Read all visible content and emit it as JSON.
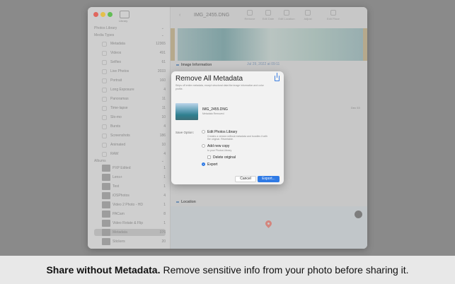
{
  "window": {
    "title": "IMG_2455.DNG",
    "traffic_colors": [
      "#e0675e",
      "#e5c04b",
      "#62bd55"
    ],
    "accent": "#2f7ae5"
  },
  "sidebar": {
    "top_label": "Library",
    "library_label": "Photos Library",
    "media_types_label": "Media Types",
    "media_types": [
      {
        "label": "Metadata",
        "count": "12365"
      },
      {
        "label": "Videos",
        "count": "491"
      },
      {
        "label": "Selfies",
        "count": "61"
      },
      {
        "label": "Live Photos",
        "count": "2033"
      },
      {
        "label": "Portrait",
        "count": "160"
      },
      {
        "label": "Long Exposure",
        "count": "4"
      },
      {
        "label": "Panoramas",
        "count": "11"
      },
      {
        "label": "Time-lapse",
        "count": "11"
      },
      {
        "label": "Slo-mo",
        "count": "10"
      },
      {
        "label": "Bursts",
        "count": "4"
      },
      {
        "label": "Screenshots",
        "count": "186"
      },
      {
        "label": "Animated",
        "count": "10"
      },
      {
        "label": "RAW",
        "count": "4"
      }
    ],
    "albums_label": "Albums",
    "albums": [
      {
        "label": "PXP Edited",
        "count": "1"
      },
      {
        "label": "Lens+",
        "count": "1"
      },
      {
        "label": "Test",
        "count": "1"
      },
      {
        "label": "iOSPhotos",
        "count": "4"
      },
      {
        "label": "Video 2 Photo - HD",
        "count": "1"
      },
      {
        "label": "PACam",
        "count": "8"
      },
      {
        "label": "Video Rotate & Flip",
        "count": "1"
      },
      {
        "label": "Metadata",
        "count": "376"
      },
      {
        "label": "Stickers",
        "count": "20"
      }
    ]
  },
  "toolbar": {
    "buttons": [
      "Remove",
      "Edit Date",
      "Edit Location",
      "Adjust",
      "Edit Place"
    ]
  },
  "info": {
    "image_info_label": "Image Information",
    "date": "Jul 29, 2022 at 09:11",
    "location_label": "Location",
    "dec_label": "Dec 53"
  },
  "dialog": {
    "title": "Remove All Metadata",
    "subtitle": "Strips off entire metadata, except structural data like image information and color profile.",
    "file_name": "IMG_2455.DNG",
    "file_status": "Metadata Removed",
    "save_option_label": "Save Option:",
    "options": [
      {
        "label": "Edit Photos Library",
        "desc": "Creates a version without metadata and bundles it with the original. Revertable.",
        "selected": false
      },
      {
        "label": "Add new copy",
        "desc": "to your Photos Library",
        "selected": false
      },
      {
        "label": "Export",
        "desc": "",
        "selected": true
      }
    ],
    "delete_original_label": "Delete original",
    "cancel_label": "Cancel",
    "export_label": "Export..."
  },
  "caption": {
    "bold": "Share without Metadata.",
    "text": "Remove sensitive info from your photo before sharing it."
  }
}
